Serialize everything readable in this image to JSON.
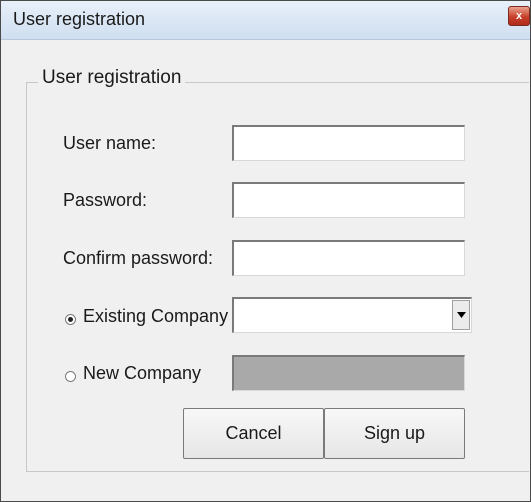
{
  "window": {
    "title": "User registration",
    "close_label": "x"
  },
  "group": {
    "legend": "User registration"
  },
  "fields": {
    "username": {
      "label": "User name:",
      "value": ""
    },
    "password": {
      "label": "Password:",
      "value": ""
    },
    "confirm_password": {
      "label": "Confirm password:",
      "value": ""
    }
  },
  "company": {
    "existing_label": "Existing Company",
    "existing_selected": true,
    "existing_value": "",
    "new_label": "New Company",
    "new_value": ""
  },
  "buttons": {
    "cancel": "Cancel",
    "signup": "Sign up"
  },
  "icons": {
    "close": "close-icon",
    "dropdown": "chevron-down-icon"
  }
}
